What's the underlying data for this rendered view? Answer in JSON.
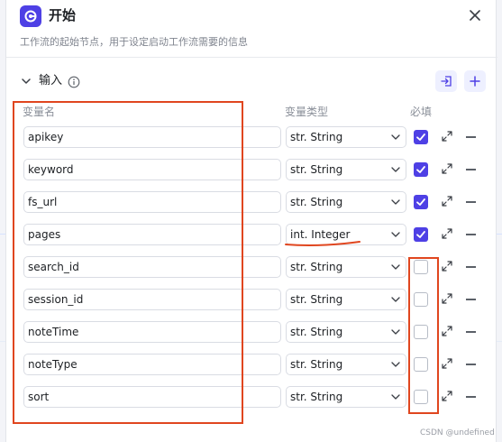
{
  "panel": {
    "title": "开始",
    "description": "工作流的起始节点，用于设定启动工作流需要的信息",
    "accent": "#4e40e5",
    "logo_icon": "start-node-icon",
    "close_icon": "close-icon"
  },
  "inputs": {
    "section_label": "输入",
    "info_icon": "info-icon",
    "import_icon": "import-icon",
    "add_icon": "plus-icon",
    "headers": {
      "name": "变量名",
      "type": "变量类型",
      "required": "必填"
    },
    "rows": [
      {
        "name": "apikey",
        "type": "str. String",
        "required": true
      },
      {
        "name": "keyword",
        "type": "str. String",
        "required": true
      },
      {
        "name": "fs_url",
        "type": "str. String",
        "required": true
      },
      {
        "name": "pages",
        "type": "int. Integer",
        "required": true
      },
      {
        "name": "search_id",
        "type": "str. String",
        "required": false
      },
      {
        "name": "session_id",
        "type": "str. String",
        "required": false
      },
      {
        "name": "noteTime",
        "type": "str. String",
        "required": false
      },
      {
        "name": "noteType",
        "type": "str. String",
        "required": false
      },
      {
        "name": "sort",
        "type": "str. String",
        "required": false
      }
    ]
  },
  "annotation_color": "#e0461f",
  "watermark": "CSDN @undefined"
}
